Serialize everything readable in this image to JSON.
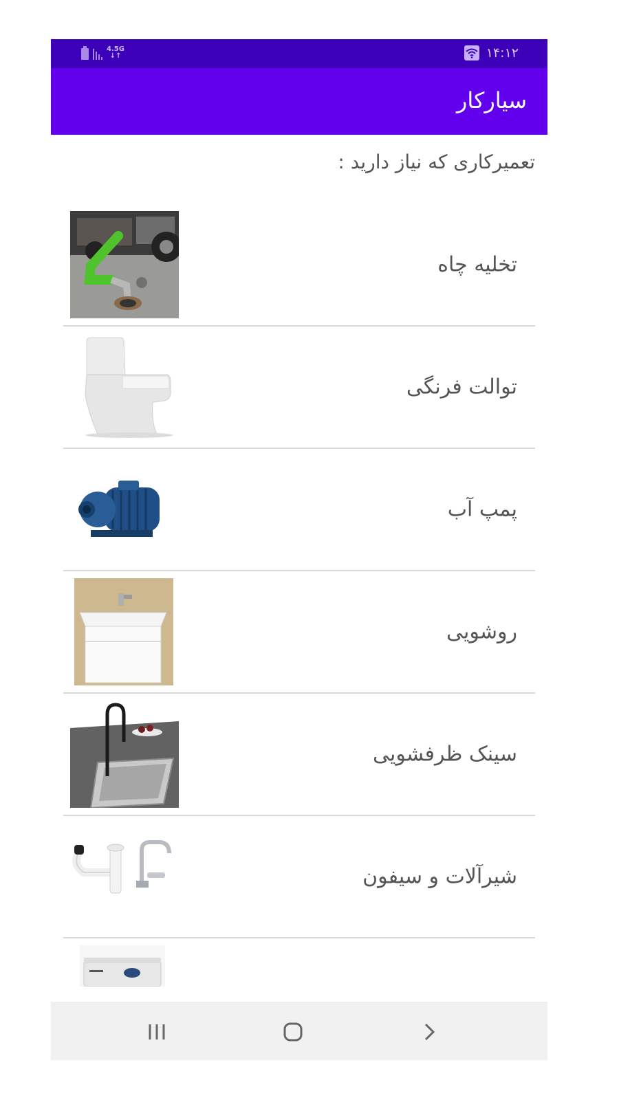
{
  "status_bar": {
    "time": "۱۴:۱۲",
    "network": "4.5G",
    "net_arrows": "↓↑",
    "icons": [
      "battery-icon",
      "signal-icon",
      "wifi-icon"
    ]
  },
  "app_bar": {
    "title": "سیارکار"
  },
  "prompt": "تعمیرکاری که نیاز دارید :",
  "services": [
    {
      "label": "تخلیه چاه",
      "icon": "septic-truck-image"
    },
    {
      "label": "توالت فرنگی",
      "icon": "toilet-image"
    },
    {
      "label": "پمپ آب",
      "icon": "water-pump-image"
    },
    {
      "label": "روشویی",
      "icon": "washbasin-image"
    },
    {
      "label": "سینک ظرفشویی",
      "icon": "kitchen-sink-image"
    },
    {
      "label": "شیرآلات و سیفون",
      "icon": "faucet-siphon-image"
    },
    {
      "label": "",
      "icon": "water-heater-image"
    }
  ],
  "nav_bar": {
    "icons": [
      "recents-icon",
      "home-icon",
      "back-icon"
    ]
  },
  "colors": {
    "status_bar": "#3b00b8",
    "app_bar": "#6200ee",
    "text": "#555555",
    "divider": "#d9d9d9",
    "nav_bar": "#f1f1f1"
  }
}
